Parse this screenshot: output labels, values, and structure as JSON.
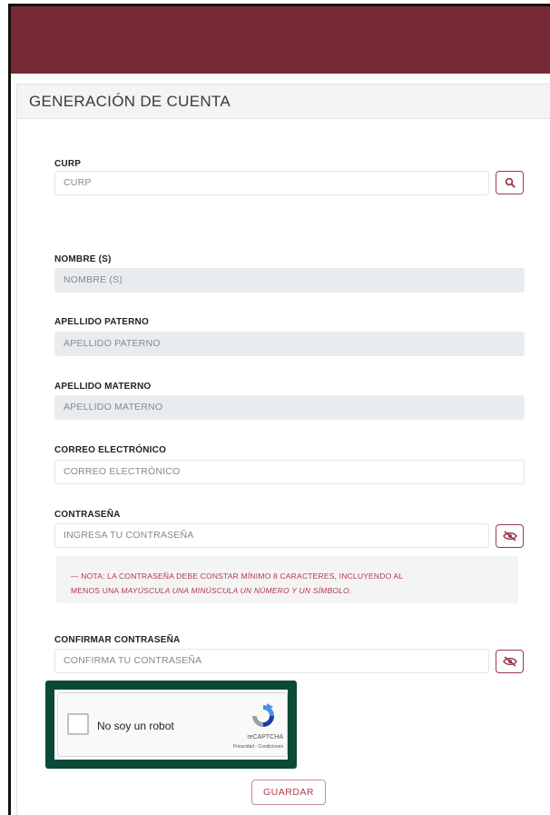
{
  "header": {
    "brand_color": "#762a33"
  },
  "card": {
    "title": "GENERACIÓN DE CUENTA"
  },
  "fields": {
    "curp": {
      "label": "CURP",
      "placeholder": "CURP",
      "button_icon": "search-icon"
    },
    "nombre": {
      "label": "NOMBRE (S)",
      "placeholder": "NOMBRE (S)"
    },
    "apellido_paterno": {
      "label": "APELLIDO PATERNO",
      "placeholder": "APELLIDO PATERNO"
    },
    "apellido_materno": {
      "label": "APELLIDO MATERNO",
      "placeholder": "APELLIDO MATERNO"
    },
    "correo": {
      "label": "CORREO ELECTRÓNICO",
      "placeholder": "CORREO ELECTRÓNICO"
    },
    "contrasena": {
      "label": "CONTRASEÑA",
      "placeholder": "INGRESA TU CONTRASEÑA",
      "button_icon": "eye-slash-icon"
    },
    "confirmar": {
      "label": "CONFIRMAR CONTRASEÑA",
      "placeholder": "CONFIRMA TU CONTRASEÑA",
      "button_icon": "eye-slash-icon"
    }
  },
  "note": {
    "prefix": "— NOTA: LA CONTRASEÑA DEBE CONSTAR MÍNIMO 8 CARACTERES, INCLUYENDO AL",
    "line2_start": "MENOS UNA ",
    "line2_italic": "MAYÚSCULA UNA MINÚSCULA UN NÚMERO Y UN SÍMBOLO."
  },
  "captcha": {
    "label": "No soy un robot",
    "brand": "reCAPTCHA",
    "links": "Privacidad - Condiciones"
  },
  "actions": {
    "save_label": "GUARDAR"
  },
  "colors": {
    "accent": "#9b3a48",
    "highlight_outline": "#0a4a38",
    "note_text": "#b23a4c"
  }
}
